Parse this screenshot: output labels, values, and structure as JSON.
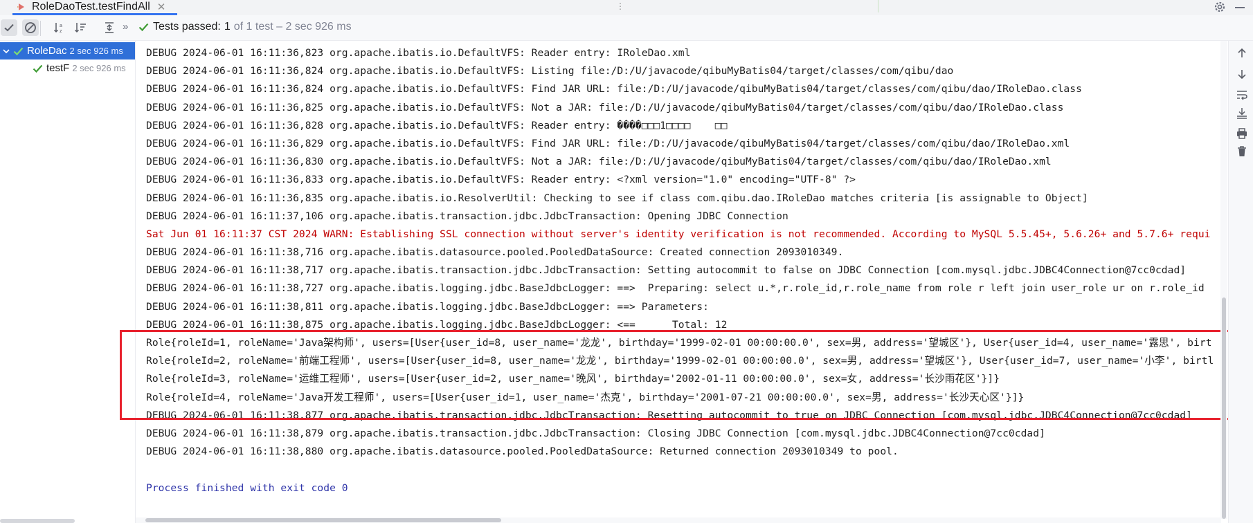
{
  "tab": {
    "title": "RoleDaoTest.testFindAll"
  },
  "toolbar": {
    "status_label": "Tests passed:",
    "passed_count": "1",
    "status_rest": "of 1 test – 2 sec 926 ms",
    "more_chevron": "»"
  },
  "tree": {
    "items": [
      {
        "label": "RoleDac",
        "duration": "2 sec 926 ms"
      },
      {
        "label": "testF",
        "duration": "2 sec 926 ms"
      }
    ]
  },
  "console": {
    "lines": [
      "DEBUG 2024-06-01 16:11:36,823 org.apache.ibatis.io.DefaultVFS: Reader entry: IRoleDao.xml",
      "DEBUG 2024-06-01 16:11:36,824 org.apache.ibatis.io.DefaultVFS: Listing file:/D:/U/javacode/qibuMyBatis04/target/classes/com/qibu/dao",
      "DEBUG 2024-06-01 16:11:36,824 org.apache.ibatis.io.DefaultVFS: Find JAR URL: file:/D:/U/javacode/qibuMyBatis04/target/classes/com/qibu/dao/IRoleDao.class",
      "DEBUG 2024-06-01 16:11:36,825 org.apache.ibatis.io.DefaultVFS: Not a JAR: file:/D:/U/javacode/qibuMyBatis04/target/classes/com/qibu/dao/IRoleDao.class",
      "DEBUG 2024-06-01 16:11:36,828 org.apache.ibatis.io.DefaultVFS: Reader entry: ����□□□1□□□□    □□",
      "DEBUG 2024-06-01 16:11:36,829 org.apache.ibatis.io.DefaultVFS: Find JAR URL: file:/D:/U/javacode/qibuMyBatis04/target/classes/com/qibu/dao/IRoleDao.xml",
      "DEBUG 2024-06-01 16:11:36,830 org.apache.ibatis.io.DefaultVFS: Not a JAR: file:/D:/U/javacode/qibuMyBatis04/target/classes/com/qibu/dao/IRoleDao.xml",
      "DEBUG 2024-06-01 16:11:36,833 org.apache.ibatis.io.DefaultVFS: Reader entry: <?xml version=\"1.0\" encoding=\"UTF-8\" ?>",
      "DEBUG 2024-06-01 16:11:36,835 org.apache.ibatis.io.ResolverUtil: Checking to see if class com.qibu.dao.IRoleDao matches criteria [is assignable to Object]",
      "DEBUG 2024-06-01 16:11:37,106 org.apache.ibatis.transaction.jdbc.JdbcTransaction: Opening JDBC Connection",
      "Sat Jun 01 16:11:37 CST 2024 WARN: Establishing SSL connection without server's identity verification is not recommended. According to MySQL 5.5.45+, 5.6.26+ and 5.7.6+ requi",
      "DEBUG 2024-06-01 16:11:38,716 org.apache.ibatis.datasource.pooled.PooledDataSource: Created connection 2093010349.",
      "DEBUG 2024-06-01 16:11:38,717 org.apache.ibatis.transaction.jdbc.JdbcTransaction: Setting autocommit to false on JDBC Connection [com.mysql.jdbc.JDBC4Connection@7cc0cdad]",
      "DEBUG 2024-06-01 16:11:38,727 org.apache.ibatis.logging.jdbc.BaseJdbcLogger: ==>  Preparing: select u.*,r.role_id,r.role_name from role r left join user_role ur on r.role_id",
      "DEBUG 2024-06-01 16:11:38,811 org.apache.ibatis.logging.jdbc.BaseJdbcLogger: ==> Parameters: ",
      "DEBUG 2024-06-01 16:11:38,875 org.apache.ibatis.logging.jdbc.BaseJdbcLogger: <==      Total: 12",
      "Role{roleId=1, roleName='Java架构师', users=[User{user_id=8, user_name='龙龙', birthday='1999-02-01 00:00:00.0', sex=男, address='望城区'}, User{user_id=4, user_name='露思', birt",
      "Role{roleId=2, roleName='前端工程师', users=[User{user_id=8, user_name='龙龙', birthday='1999-02-01 00:00:00.0', sex=男, address='望城区'}, User{user_id=7, user_name='小李', birtl",
      "Role{roleId=3, roleName='运维工程师', users=[User{user_id=2, user_name='晚风', birthday='2002-01-11 00:00:00.0', sex=女, address='长沙雨花区'}]}",
      "Role{roleId=4, roleName='Java开发工程师', users=[User{user_id=1, user_name='杰克', birthday='2001-07-21 00:00:00.0', sex=男, address='长沙天心区'}]}",
      "DEBUG 2024-06-01 16:11:38,877 org.apache.ibatis.transaction.jdbc.JdbcTransaction: Resetting autocommit to true on JDBC Connection [com.mysql.jdbc.JDBC4Connection@7cc0cdad]",
      "DEBUG 2024-06-01 16:11:38,879 org.apache.ibatis.transaction.jdbc.JdbcTransaction: Closing JDBC Connection [com.mysql.jdbc.JDBC4Connection@7cc0cdad]",
      "DEBUG 2024-06-01 16:11:38,880 org.apache.ibatis.datasource.pooled.PooledDataSource: Returned connection 2093010349 to pool.",
      "",
      "Process finished with exit code 0"
    ]
  },
  "colors": {
    "warn": "#c00000",
    "exit": "#2d33a8",
    "pass": "#3f9c35",
    "selection": "#2f6fd8",
    "highlight": "#e8222e"
  },
  "icons": {
    "toolbar": [
      "check-icon",
      "cancel-icon",
      "sort-alpha-icon",
      "sort-duration-icon",
      "expand-collapse-icon"
    ],
    "gutter": [
      "up-arrow-icon",
      "down-arrow-icon",
      "soft-wrap-icon",
      "scroll-to-end-icon",
      "print-icon",
      "trash-icon"
    ]
  }
}
